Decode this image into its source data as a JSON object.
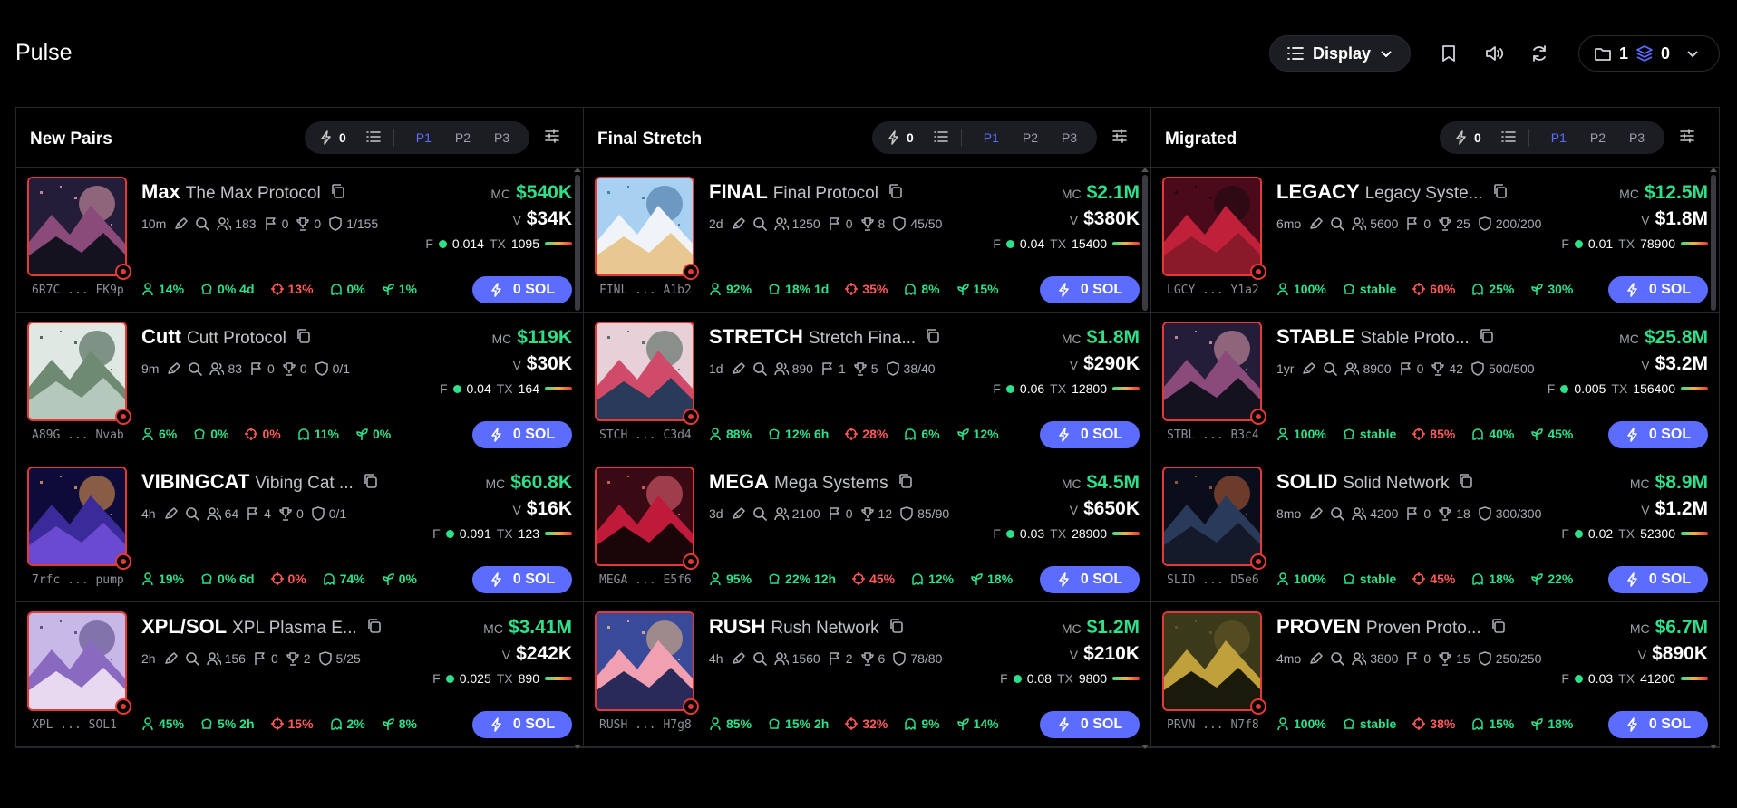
{
  "app": {
    "title": "Pulse"
  },
  "toolbar": {
    "display_label": "Display",
    "wallet_count": "1",
    "layers_count": "0"
  },
  "panels": [
    {
      "title": "New Pairs",
      "bolt_count": "0",
      "presets": [
        "P1",
        "P2",
        "P3"
      ],
      "cards": [
        {
          "ticker": "Max",
          "name": "The Max Protocol",
          "age": "10m",
          "holders": "183",
          "flags": "0",
          "trophy": "0",
          "shield": "1/155",
          "mc": "$540K",
          "vol": "$34K",
          "f": "0.014",
          "tx": "1095",
          "s1": "14%",
          "s2": "0% 4d",
          "s3": "13%",
          "s4": "0%",
          "s5": "1%",
          "addr_a": "6R7C",
          "addr_b": "FK9p",
          "sol": "0 SOL",
          "art": [
            "#231d3a",
            "#8a4a7a",
            "#e8a0b0",
            "#15121f"
          ]
        },
        {
          "ticker": "Cutt",
          "name": "Cutt Protocol",
          "age": "9m",
          "holders": "83",
          "flags": "0",
          "trophy": "0",
          "shield": "0/1",
          "mc": "$119K",
          "vol": "$30K",
          "f": "0.04",
          "tx": "164",
          "s1": "6%",
          "s2": "0%",
          "s3": "0%",
          "s4": "11%",
          "s5": "0%",
          "addr_a": "A89G",
          "addr_b": "Nvab",
          "sol": "0 SOL",
          "art": [
            "#dfe8e2",
            "#6e8a72",
            "#2e4a3a",
            "#b4c8bc"
          ]
        },
        {
          "ticker": "VIBINGCAT",
          "name": "Vibing Cat ...",
          "age": "4h",
          "holders": "64",
          "flags": "4",
          "trophy": "0",
          "shield": "0/1",
          "mc": "$60.8K",
          "vol": "$16K",
          "f": "0.091",
          "tx": "123",
          "s1": "19%",
          "s2": "0% 6d",
          "s3": "0%",
          "s4": "74%",
          "s5": "0%",
          "addr_a": "7rfc",
          "addr_b": "pump",
          "sol": "0 SOL",
          "art": [
            "#0d0b3a",
            "#3a2a9a",
            "#f0a050",
            "#6a4ad0"
          ]
        },
        {
          "ticker": "XPL/SOL",
          "name": "XPL Plasma E...",
          "age": "2h",
          "holders": "156",
          "flags": "0",
          "trophy": "2",
          "shield": "5/25",
          "mc": "$3.41M",
          "vol": "$242K",
          "f": "0.025",
          "tx": "890",
          "s1": "45%",
          "s2": "5% 2h",
          "s3": "15%",
          "s4": "2%",
          "s5": "8%",
          "addr_a": "XPL",
          "addr_b": "SOL1",
          "sol": "0 SOL",
          "art": [
            "#c8b8e8",
            "#8a6ac0",
            "#4a3a7a",
            "#e8d8f0"
          ]
        }
      ]
    },
    {
      "title": "Final Stretch",
      "bolt_count": "0",
      "presets": [
        "P1",
        "P2",
        "P3"
      ],
      "cards": [
        {
          "ticker": "FINAL",
          "name": "Final Protocol",
          "age": "2d",
          "holders": "1250",
          "flags": "0",
          "trophy": "8",
          "shield": "45/50",
          "mc": "$2.1M",
          "vol": "$380K",
          "f": "0.04",
          "tx": "15400",
          "s1": "92%",
          "s2": "18% 1d",
          "s3": "35%",
          "s4": "8%",
          "s5": "15%",
          "addr_a": "FINL",
          "addr_b": "A1b2",
          "sol": "0 SOL",
          "art": [
            "#a8d0f0",
            "#f0f4f8",
            "#3a6a9a",
            "#e8c890"
          ]
        },
        {
          "ticker": "STRETCH",
          "name": "Stretch Fina...",
          "age": "1d",
          "holders": "890",
          "flags": "1",
          "trophy": "5",
          "shield": "38/40",
          "mc": "$1.8M",
          "vol": "$290K",
          "f": "0.06",
          "tx": "12800",
          "s1": "88%",
          "s2": "12% 6h",
          "s3": "28%",
          "s4": "6%",
          "s5": "12%",
          "addr_a": "STCH",
          "addr_b": "C3d4",
          "sol": "0 SOL",
          "art": [
            "#e8d0d8",
            "#d04a6a",
            "#3a5a4a",
            "#2a3a5a"
          ]
        },
        {
          "ticker": "MEGA",
          "name": "Mega Systems",
          "age": "3d",
          "holders": "2100",
          "flags": "0",
          "trophy": "12",
          "shield": "85/90",
          "mc": "$4.5M",
          "vol": "$650K",
          "f": "0.03",
          "tx": "28900",
          "s1": "95%",
          "s2": "22% 12h",
          "s3": "45%",
          "s4": "12%",
          "s5": "18%",
          "addr_a": "MEGA",
          "addr_b": "E5f6",
          "sol": "0 SOL",
          "art": [
            "#3a0a14",
            "#c01a3a",
            "#f06a7a",
            "#1a0508"
          ]
        },
        {
          "ticker": "RUSH",
          "name": "Rush Network",
          "age": "4h",
          "holders": "1560",
          "flags": "2",
          "trophy": "6",
          "shield": "78/80",
          "mc": "$1.2M",
          "vol": "$210K",
          "f": "0.08",
          "tx": "9800",
          "s1": "85%",
          "s2": "15% 2h",
          "s3": "32%",
          "s4": "9%",
          "s5": "14%",
          "addr_a": "RUSH",
          "addr_b": "H7g8",
          "sol": "0 SOL",
          "art": [
            "#3a4a9a",
            "#f0a0b0",
            "#f0c080",
            "#2a2a5a"
          ]
        }
      ]
    },
    {
      "title": "Migrated",
      "bolt_count": "0",
      "presets": [
        "P1",
        "P2",
        "P3"
      ],
      "cards": [
        {
          "ticker": "LEGACY",
          "name": "Legacy Syste...",
          "age": "6mo",
          "holders": "5600",
          "flags": "0",
          "trophy": "25",
          "shield": "200/200",
          "mc": "$12.5M",
          "vol": "$1.8M",
          "f": "0.01",
          "tx": "78900",
          "s1": "100%",
          "s2": "stable",
          "s3": "60%",
          "s4": "25%",
          "s5": "30%",
          "addr_a": "LGCY",
          "addr_b": "Y1a2",
          "sol": "0 SOL",
          "art": [
            "#4a0a1a",
            "#c0203a",
            "#1a0a10",
            "#8a1a2a"
          ]
        },
        {
          "ticker": "STABLE",
          "name": "Stable Proto...",
          "age": "1yr",
          "holders": "8900",
          "flags": "0",
          "trophy": "42",
          "shield": "500/500",
          "mc": "$25.8M",
          "vol": "$3.2M",
          "f": "0.005",
          "tx": "156400",
          "s1": "100%",
          "s2": "stable",
          "s3": "85%",
          "s4": "40%",
          "s5": "45%",
          "addr_a": "STBL",
          "addr_b": "B3c4",
          "sol": "0 SOL",
          "art": [
            "#231d3a",
            "#8a4a7a",
            "#e8a0b0",
            "#15121f"
          ]
        },
        {
          "ticker": "SOLID",
          "name": "Solid Network",
          "age": "8mo",
          "holders": "4200",
          "flags": "0",
          "trophy": "18",
          "shield": "300/300",
          "mc": "$8.9M",
          "vol": "$1.2M",
          "f": "0.02",
          "tx": "52300",
          "s1": "100%",
          "s2": "stable",
          "s3": "45%",
          "s4": "18%",
          "s5": "22%",
          "addr_a": "SLID",
          "addr_b": "D5e6",
          "sol": "0 SOL",
          "art": [
            "#0a0e1a",
            "#2a3a5a",
            "#c0603a",
            "#141a2a"
          ]
        },
        {
          "ticker": "PROVEN",
          "name": "Proven Proto...",
          "age": "4mo",
          "holders": "3800",
          "flags": "0",
          "trophy": "15",
          "shield": "250/250",
          "mc": "$6.7M",
          "vol": "$890K",
          "f": "0.03",
          "tx": "41200",
          "s1": "100%",
          "s2": "stable",
          "s3": "38%",
          "s4": "15%",
          "s5": "18%",
          "addr_a": "PRVN",
          "addr_b": "N7f8",
          "sol": "0 SOL",
          "art": [
            "#3a3a1a",
            "#c0a03a",
            "#6a5a2a",
            "#1a1a0a"
          ]
        }
      ]
    }
  ],
  "colors": {
    "accent": "#5b6cff",
    "positive": "#2ee08a",
    "negative": "#ff5a5a",
    "thumb_border": "#e53935"
  }
}
